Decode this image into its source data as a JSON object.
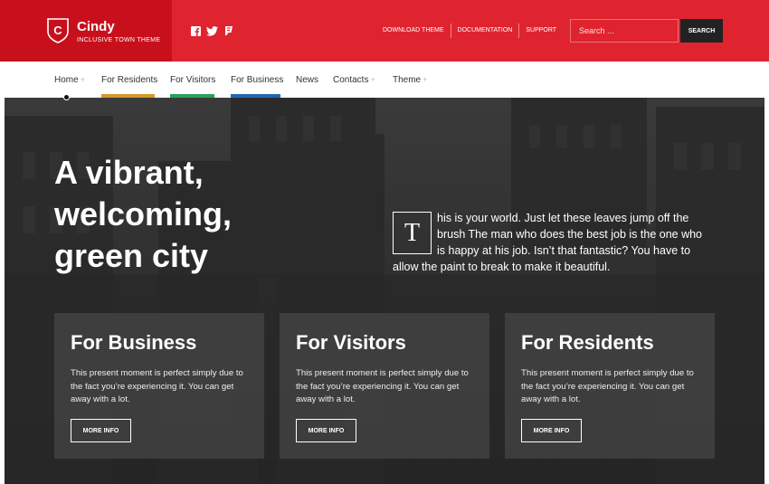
{
  "brand": {
    "initial": "C",
    "name": "Cindy",
    "tagline": "INCLUSIVE TOWN THEME"
  },
  "social_icons": [
    "facebook-icon",
    "twitter-icon",
    "foursquare-icon"
  ],
  "top_links": [
    "DOWNLOAD THEME",
    "DOCUMENTATION",
    "SUPPORT"
  ],
  "search": {
    "placeholder": "Search ...",
    "button": "SEARCH"
  },
  "nav": [
    {
      "label": "Home",
      "has_submenu": true,
      "accent": ""
    },
    {
      "label": "For Residents",
      "has_submenu": false,
      "accent": "#d9962b"
    },
    {
      "label": "For Visitors",
      "has_submenu": false,
      "accent": "#2aa15a"
    },
    {
      "label": "For Business",
      "has_submenu": false,
      "accent": "#1f6ab0"
    },
    {
      "label": "News",
      "has_submenu": false,
      "accent": ""
    },
    {
      "label": "Contacts",
      "has_submenu": true,
      "accent": ""
    },
    {
      "label": "Theme",
      "has_submenu": true,
      "accent": ""
    }
  ],
  "hero": {
    "headline": [
      "A vibrant,",
      "welcoming,",
      "green city"
    ],
    "dropcap": "T",
    "intro_lines": [
      "his is your world. Just let these leaves jump off the",
      "brush The man who does the best job is the one who",
      "is happy at his job. Isn’t that fantastic? You have to",
      "allow the paint to break to make it beautiful."
    ]
  },
  "cards": [
    {
      "title": "For Business",
      "text": "This present moment is perfect simply due to the fact you’re experiencing it. You can get away with a lot.",
      "button": "MORE INFO"
    },
    {
      "title": "For Visitors",
      "text": "This present moment is perfect simply due to the fact you’re experiencing it. You can get away with a lot.",
      "button": "MORE INFO"
    },
    {
      "title": "For Residents",
      "text": "This present moment is perfect simply due to the fact you’re experiencing it. You can get away with a lot.",
      "button": "MORE INFO"
    }
  ],
  "colors": {
    "header_red": "#e0242f",
    "brand_red": "#c7101c",
    "search_button": "#222222"
  }
}
